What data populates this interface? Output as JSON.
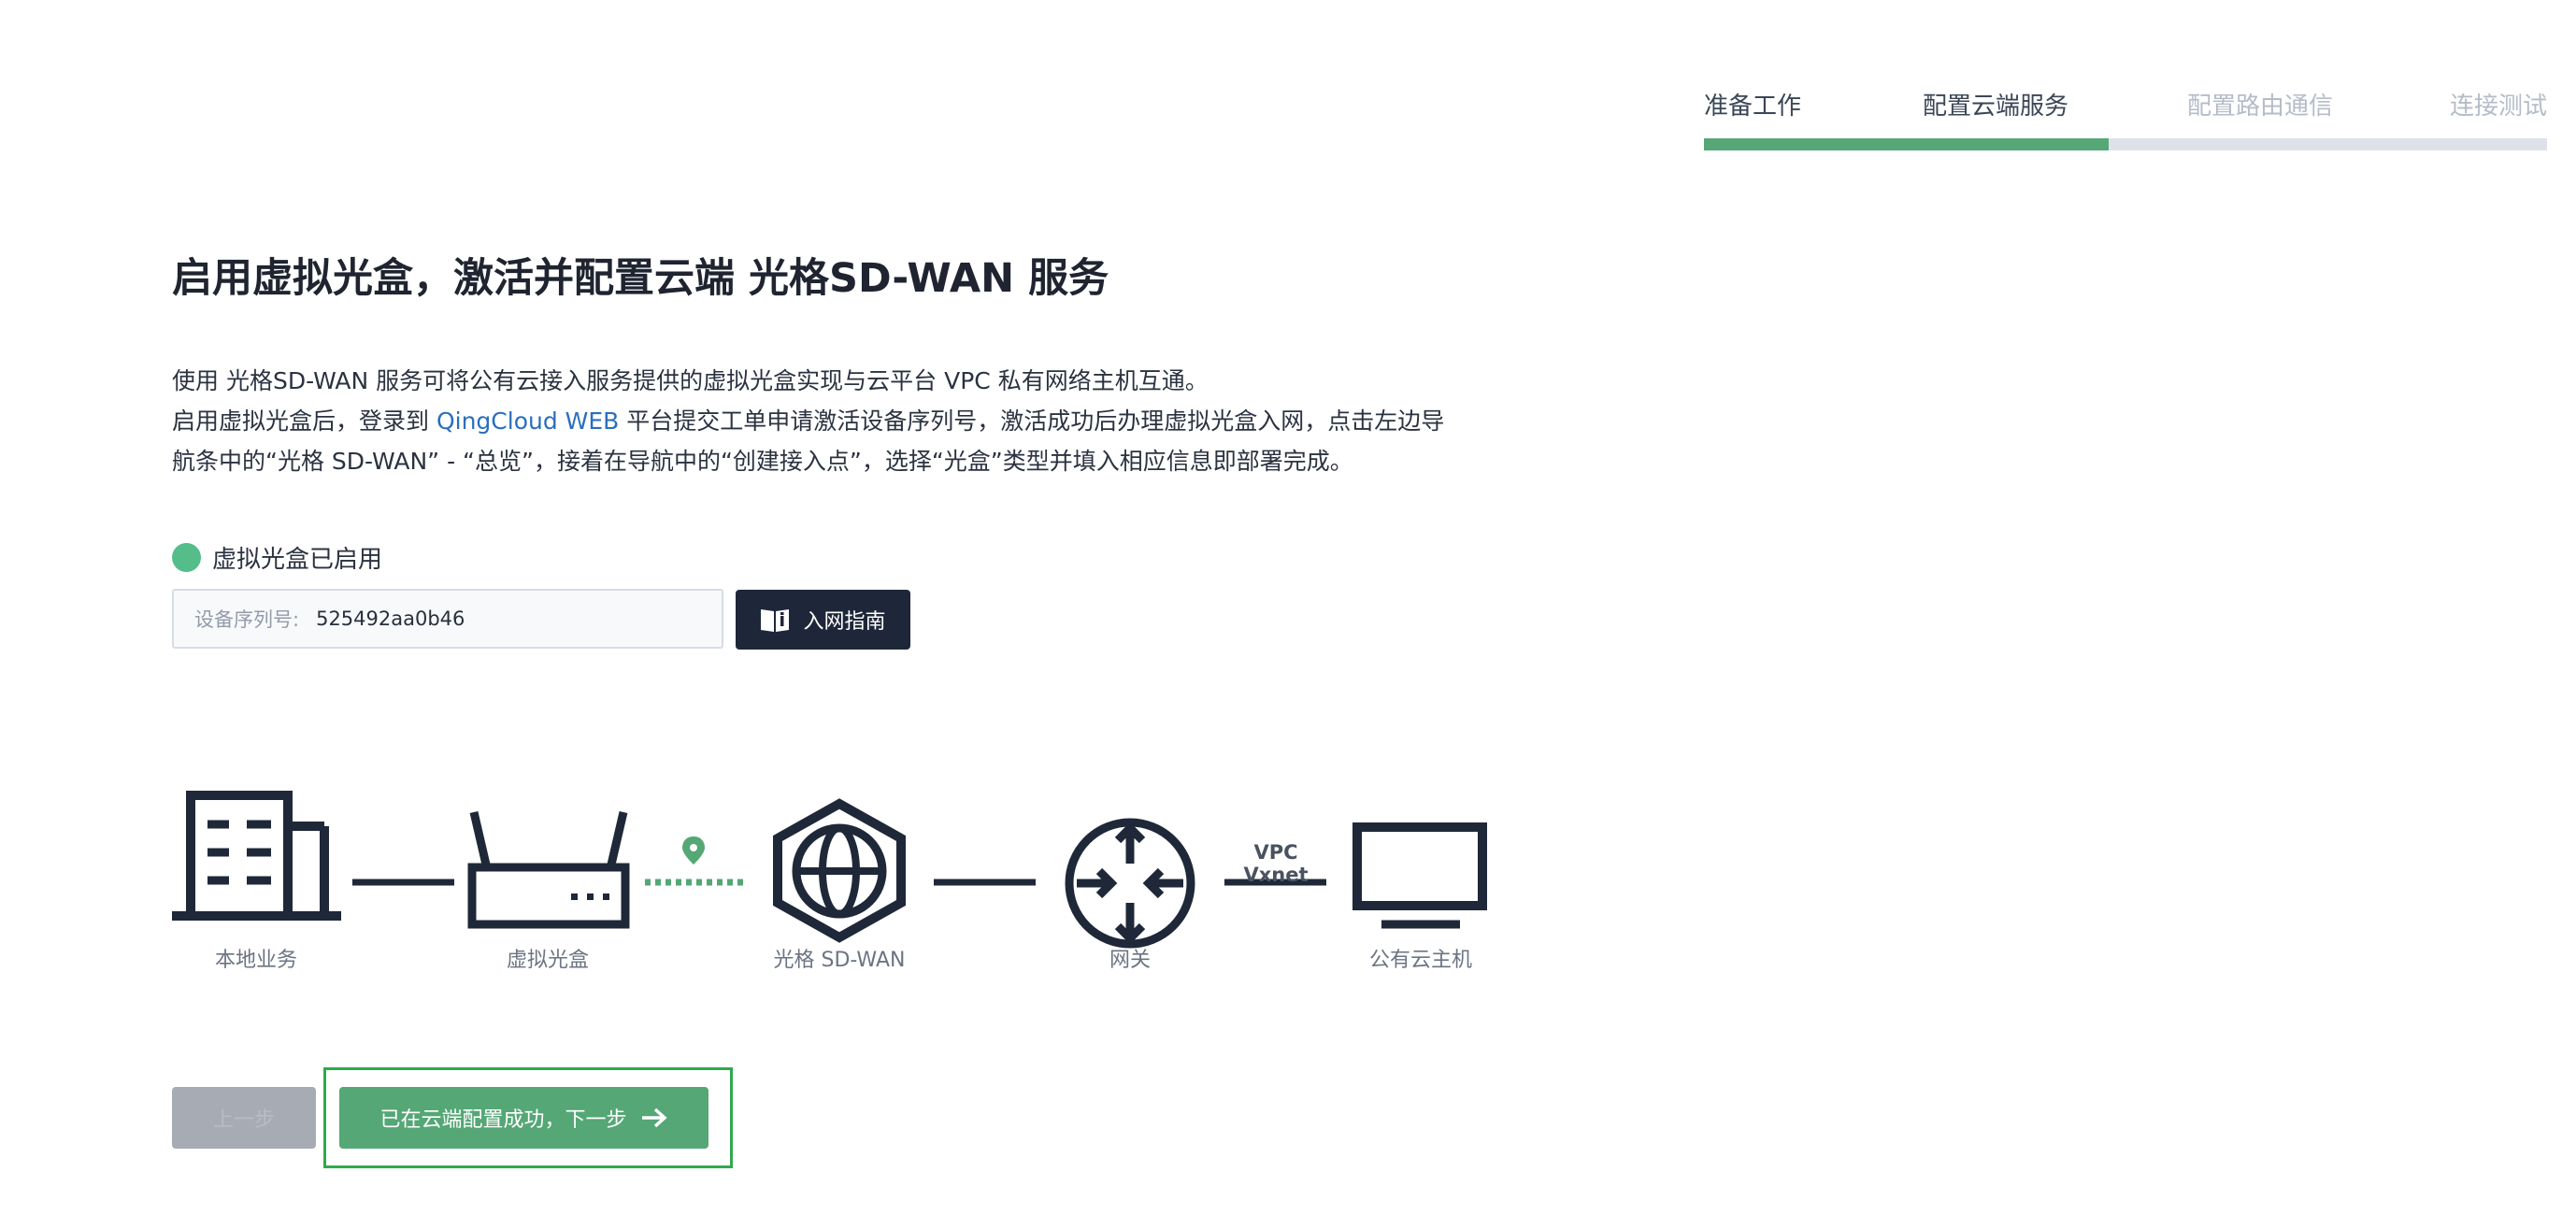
{
  "stepper": {
    "steps": [
      {
        "label": "准备工作",
        "state": "done"
      },
      {
        "label": "配置云端服务",
        "state": "done"
      },
      {
        "label": "配置路由通信",
        "state": "todo"
      },
      {
        "label": "连接测试",
        "state": "todo"
      }
    ],
    "progress_fraction": 0.48,
    "colors": {
      "done": "#55a776",
      "todo": "#dde2ea"
    }
  },
  "page": {
    "title": "启用虚拟光盒，激活并配置云端 光格SD-WAN 服务",
    "desc_line1": "使用 光格SD-WAN 服务可将公有云接入服务提供的虚拟光盒实现与云平台 VPC 私有网络主机互通。",
    "desc_line2_before": "启用虚拟光盒后，登录到 ",
    "desc_line2_link": "QingCloud WEB",
    "desc_line2_after": " 平台提交工单申请激活设备序列号，激活成功后办理虚拟光盒入网，点击左边导",
    "desc_line3": "航条中的“光格 SD-WAN” - “总览”，接着在导航中的“创建接入点”，选择“光盒”类型并填入相应信息即部署完成。"
  },
  "status": {
    "text": "虚拟光盒已启用",
    "color": "#55bd8a"
  },
  "serial": {
    "label": "设备序列号:",
    "value": "525492aa0b46"
  },
  "guide_button": {
    "label": "入网指南",
    "icon": "book-info-icon"
  },
  "diagram": {
    "nodes": [
      {
        "label": "本地业务",
        "icon": "building-icon"
      },
      {
        "label": "虚拟光盒",
        "icon": "router-icon"
      },
      {
        "label": "光格 SD-WAN",
        "icon": "globe-hexagon-icon"
      },
      {
        "label": "网关",
        "icon": "gateway-icon"
      },
      {
        "label": "公有云主机",
        "icon": "monitor-icon"
      }
    ],
    "link_label": "VPC Vxnet",
    "pin_icon": "location-pin-icon"
  },
  "buttons": {
    "prev": "上一步",
    "next": "已在云端配置成功，下一步",
    "next_icon": "arrow-right-icon"
  }
}
